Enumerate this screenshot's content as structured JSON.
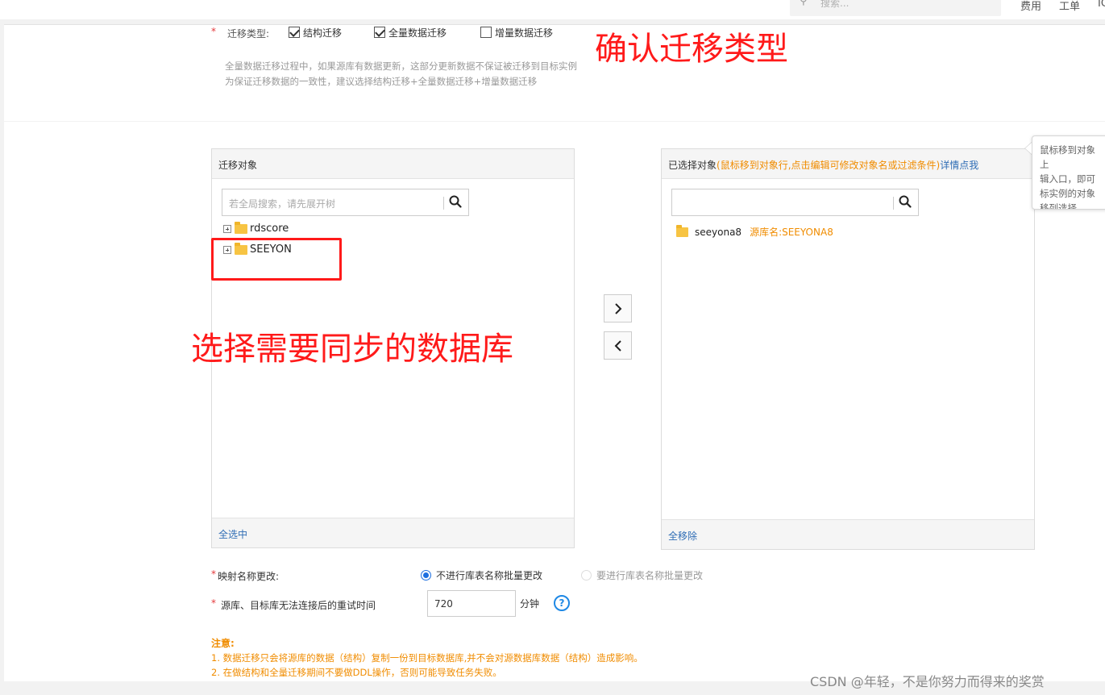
{
  "topbar": {
    "search_placeholder": "搜索...",
    "links": [
      "费用",
      "工单",
      "IC"
    ]
  },
  "migration_type": {
    "required_mark": "*",
    "label": "迁移类型:",
    "options": [
      {
        "label": "结构迁移",
        "checked": true
      },
      {
        "label": "全量数据迁移",
        "checked": true
      },
      {
        "label": "增量数据迁移",
        "checked": false
      }
    ],
    "note_line1": "全量数据迁移过程中，如果源库有数据更新，这部分更新数据不保证被迁移到目标实例",
    "note_line2": "为保证迁移数据的一致性，建议选择结构迁移+全量数据迁移+增量数据迁移"
  },
  "annotations": {
    "confirm_type": "确认迁移类型",
    "select_db": "选择需要同步的数据库",
    "color": "#ff1a1a"
  },
  "source_panel": {
    "title": "迁移对象",
    "search_placeholder": "若全局搜索，请先展开树",
    "tree": [
      {
        "label": "rdscore"
      },
      {
        "label": "SEEYON"
      }
    ],
    "footer": "全选中"
  },
  "target_panel": {
    "title": "已选择对象",
    "hint": "(鼠标移到对象行,点击编辑可修改对象名或过滤条件)",
    "help_link": "详情点我",
    "search_placeholder": "",
    "items": [
      {
        "name": "seeyona8",
        "source": "源库名:SEEYONA8"
      }
    ],
    "footer": "全移除"
  },
  "transfer": {
    "add_icon": "chevron-right-icon",
    "remove_icon": "chevron-left-icon"
  },
  "tooltip": {
    "lines": [
      "鼠标移到对象上",
      "辑入口，即可",
      "标实例的对象",
      "移列选择"
    ]
  },
  "mapping": {
    "required_mark": "*",
    "label": "映射名称更改:",
    "options": [
      {
        "label": "不进行库表名称批量更改",
        "selected": true
      },
      {
        "label": "要进行库表名称批量更改",
        "selected": false
      }
    ]
  },
  "retry": {
    "required_mark": "*",
    "label": "源库、目标库无法连接后的重试时间",
    "value": "720",
    "unit": "分钟",
    "help_icon": "?"
  },
  "notice": {
    "title": "注意:",
    "line1": "1. 数据迁移只会将源库的数据（结构）复制一份到目标数据库,并不会对源数据库数据（结构）造成影响。",
    "line2": "2. 在做结构和全量迁移期间不要做DDL操作，否则可能导致任务失败。",
    "color": "#f08c00"
  },
  "watermark": "CSDN @年轻，不是你努力而得来的奖赏",
  "colors": {
    "link": "#2f6db5",
    "hint": "#f08c00",
    "radio": "#1d6fe0",
    "help": "#1e88e5"
  }
}
